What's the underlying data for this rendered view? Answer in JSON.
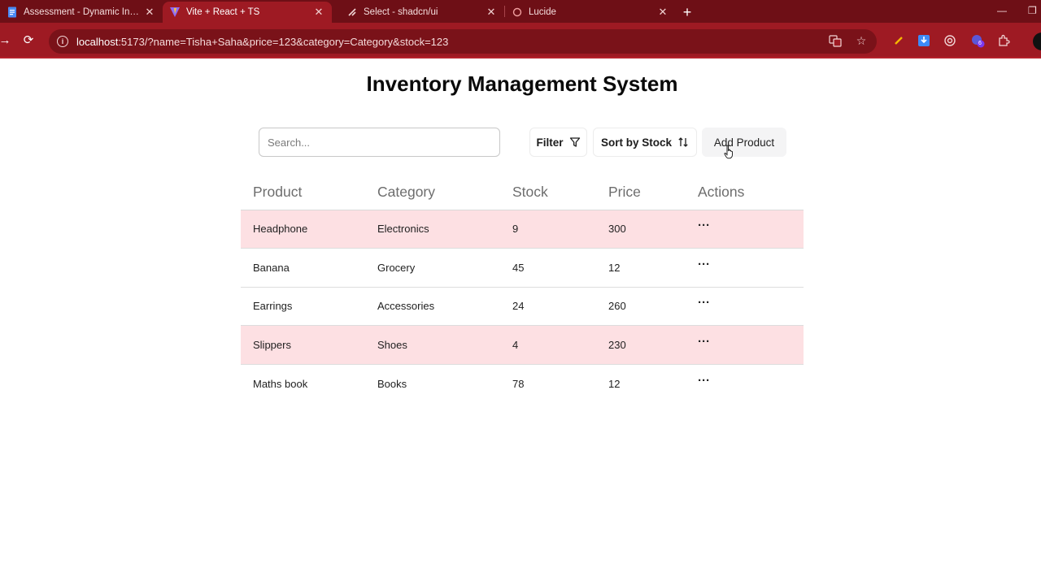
{
  "browser": {
    "tabs": [
      {
        "title": "Assessment - Dynamic Inventory",
        "icon": "document-icon",
        "active": false
      },
      {
        "title": "Vite + React + TS",
        "icon": "vite-icon",
        "active": true
      },
      {
        "title": "Select - shadcn/ui",
        "icon": "shadcn-icon",
        "active": false
      },
      {
        "title": "Lucide",
        "icon": "lucide-icon",
        "active": false
      }
    ],
    "url_host": "localhost",
    "url_rest": ":5173/?name=Tisha+Saha&price=123&category=Category&stock=123",
    "extension_badge": "6",
    "theme_color": "#9e1a23"
  },
  "app": {
    "title": "Inventory Management System",
    "search_placeholder": "Search...",
    "filter_label": "Filter",
    "sort_label": "Sort by Stock",
    "add_label": "Add Product",
    "columns": [
      "Product",
      "Category",
      "Stock",
      "Price",
      "Actions"
    ],
    "actions_label": "···",
    "low_stock_color": "#fde0e3",
    "rows": [
      {
        "product": "Headphone",
        "category": "Electronics",
        "stock": "9",
        "price": "300",
        "low": true
      },
      {
        "product": "Banana",
        "category": "Grocery",
        "stock": "45",
        "price": "12",
        "low": false
      },
      {
        "product": "Earrings",
        "category": "Accessories",
        "stock": "24",
        "price": "260",
        "low": false
      },
      {
        "product": "Slippers",
        "category": "Shoes",
        "stock": "4",
        "price": "230",
        "low": true
      },
      {
        "product": "Maths book",
        "category": "Books",
        "stock": "78",
        "price": "12",
        "low": false
      }
    ]
  }
}
